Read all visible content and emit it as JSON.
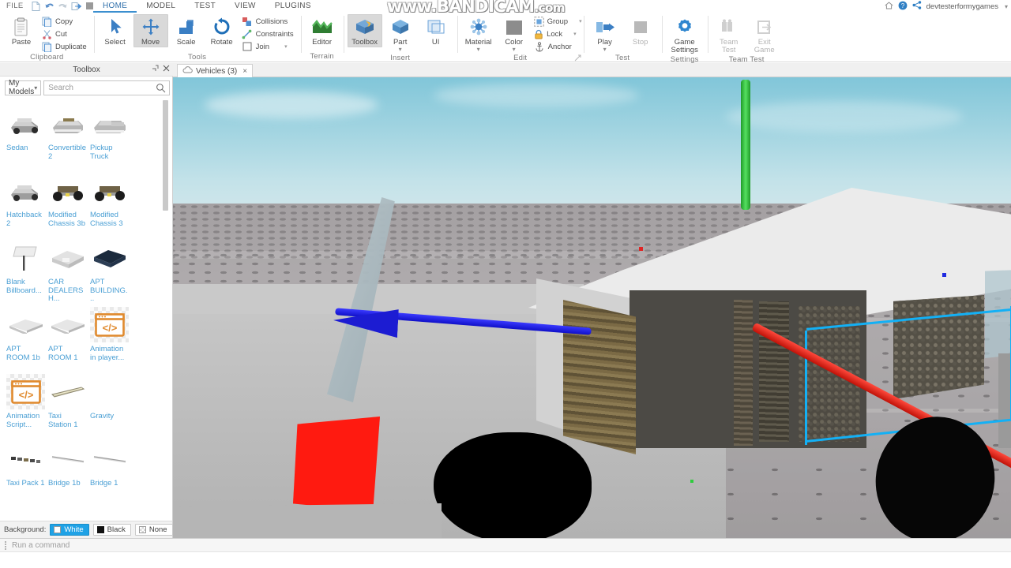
{
  "window": {
    "file_menu": "FILE",
    "account_name": "devtesterformygames",
    "watermark_main": "www.BANDICAM",
    "watermark_suffix": ".com"
  },
  "quick_access": [
    {
      "name": "new-file-icon",
      "label": "New"
    },
    {
      "name": "undo-icon",
      "label": "Undo"
    },
    {
      "name": "redo-icon",
      "label": "Redo"
    },
    {
      "name": "publish-icon",
      "label": "Publish"
    },
    {
      "name": "stop-icon",
      "label": "Stop"
    },
    {
      "name": "customize-qat-icon",
      "label": "Customize"
    }
  ],
  "ribbon_tabs": [
    {
      "label": "HOME",
      "active": true
    },
    {
      "label": "MODEL",
      "active": false
    },
    {
      "label": "TEST",
      "active": false
    },
    {
      "label": "VIEW",
      "active": false
    },
    {
      "label": "PLUGINS",
      "active": false
    }
  ],
  "ribbon_groups": [
    {
      "label": "Clipboard",
      "big": [
        {
          "label": "Paste",
          "icon": "paste-icon",
          "selected": false,
          "disabled": false
        }
      ],
      "small": [
        {
          "label": "Copy",
          "icon": "copy-icon",
          "caret": false
        },
        {
          "label": "Cut",
          "icon": "cut-icon",
          "caret": false
        },
        {
          "label": "Duplicate",
          "icon": "duplicate-icon",
          "caret": false
        }
      ]
    },
    {
      "label": "Tools",
      "big": [
        {
          "label": "Select",
          "icon": "select-arrow-icon",
          "selected": false,
          "disabled": false
        },
        {
          "label": "Move",
          "icon": "move-icon",
          "selected": true,
          "disabled": false
        },
        {
          "label": "Scale",
          "icon": "scale-icon",
          "selected": false,
          "disabled": false
        },
        {
          "label": "Rotate",
          "icon": "rotate-icon",
          "selected": false,
          "disabled": false
        }
      ],
      "small": [
        {
          "label": "Collisions",
          "icon": "collisions-icon",
          "caret": false
        },
        {
          "label": "Constraints",
          "icon": "constraints-icon",
          "caret": false
        },
        {
          "label": "Join",
          "icon": "join-checkbox-icon",
          "caret": true
        }
      ]
    },
    {
      "label": "Terrain",
      "big": [
        {
          "label": "Editor",
          "icon": "terrain-editor-icon",
          "selected": false,
          "disabled": false
        }
      ],
      "small": []
    },
    {
      "label": "Insert",
      "big": [
        {
          "label": "Toolbox",
          "icon": "toolbox-icon",
          "selected": true,
          "disabled": false
        },
        {
          "label": "Part",
          "icon": "part-icon",
          "selected": false,
          "disabled": false,
          "sub": "▾"
        },
        {
          "label": "UI",
          "icon": "ui-icon",
          "selected": false,
          "disabled": false
        }
      ],
      "small": []
    },
    {
      "label": "Edit",
      "big": [
        {
          "label": "Material",
          "icon": "material-icon",
          "selected": false,
          "disabled": false,
          "sub": "▾"
        },
        {
          "label": "Color",
          "icon": "color-icon",
          "selected": false,
          "disabled": false,
          "sub": "▾"
        }
      ],
      "small": [
        {
          "label": "Group",
          "icon": "group-icon",
          "caret": true
        },
        {
          "label": "Lock",
          "icon": "lock-icon",
          "caret": true
        },
        {
          "label": "Anchor",
          "icon": "anchor-icon",
          "caret": false
        }
      ]
    },
    {
      "label": "Test",
      "big": [
        {
          "label": "Play",
          "icon": "play-icon",
          "selected": false,
          "disabled": false,
          "sub": "▾"
        },
        {
          "label": "Stop",
          "icon": "stop-square-icon",
          "selected": false,
          "disabled": true
        }
      ],
      "small": []
    },
    {
      "label": "Settings",
      "big": [
        {
          "label": "Game Settings",
          "icon": "game-settings-gear-icon",
          "selected": false,
          "disabled": false
        }
      ],
      "small": []
    },
    {
      "label": "Team Test",
      "big": [
        {
          "label": "Team Test",
          "icon": "team-test-icon",
          "selected": false,
          "disabled": true
        },
        {
          "label": "Exit Game",
          "icon": "exit-game-icon",
          "selected": false,
          "disabled": true
        }
      ],
      "small": []
    }
  ],
  "toolbox": {
    "title": "Toolbox",
    "pin_icon": "pin-icon",
    "close_icon": "close-icon",
    "category": "My Models",
    "search_placeholder": "Search",
    "search_value": "",
    "search_icon": "search-icon",
    "items": [
      {
        "name": "Sedan",
        "thumb": "car"
      },
      {
        "name": "Convertible 2",
        "thumb": "car-open"
      },
      {
        "name": "Pickup Truck",
        "thumb": "truck"
      },
      {
        "name": "Hatchback 2",
        "thumb": "car"
      },
      {
        "name": "Modified Chassis 3b",
        "thumb": "chassis"
      },
      {
        "name": "Modified Chassis 3",
        "thumb": "chassis"
      },
      {
        "name": "Blank Billboard...",
        "thumb": "billboard"
      },
      {
        "name": "CAR DEALERSH...",
        "thumb": "building"
      },
      {
        "name": "APT BUILDING...",
        "thumb": "dark-building"
      },
      {
        "name": "APT ROOM 1b",
        "thumb": "slab"
      },
      {
        "name": "APT ROOM 1",
        "thumb": "slab"
      },
      {
        "name": "Animation in player...",
        "thumb": "script"
      },
      {
        "name": "Animation Script...",
        "thumb": "script"
      },
      {
        "name": "Taxi Station 1",
        "thumb": "rod"
      },
      {
        "name": "Gravity",
        "thumb": "blank"
      },
      {
        "name": "Taxi Pack 1",
        "thumb": "pack"
      },
      {
        "name": "Bridge 1b",
        "thumb": "bar"
      },
      {
        "name": "Bridge 1",
        "thumb": "bar"
      }
    ],
    "background_label": "Background:",
    "background_options": [
      {
        "label": "White",
        "swatch": "white",
        "selected": true
      },
      {
        "label": "Black",
        "swatch": "black",
        "selected": false
      },
      {
        "label": "None",
        "swatch": "none",
        "selected": false
      }
    ]
  },
  "viewport": {
    "tab_label": "Vehicles (3)",
    "tab_icon": "cloud-icon",
    "tab_close": "×",
    "gizmo": {
      "tool": "Move",
      "axes": [
        {
          "axis": "X",
          "color": "#e02020"
        },
        {
          "axis": "Y",
          "color": "#2ecc3d"
        },
        {
          "axis": "Z",
          "color": "#1f2ae0"
        }
      ]
    },
    "selection_color": "#13b0f5"
  },
  "command_bar": {
    "placeholder": "Run a command",
    "value": "",
    "grip_icon": "drag-grip-icon"
  },
  "colors": {
    "ribbon_bg": "#ffffff",
    "accent": "#3b8fcf",
    "panel_bg": "#f0f0f0",
    "link": "#4a9fd4",
    "sky_top": "#81c6d9",
    "ground": "#9a9698"
  }
}
